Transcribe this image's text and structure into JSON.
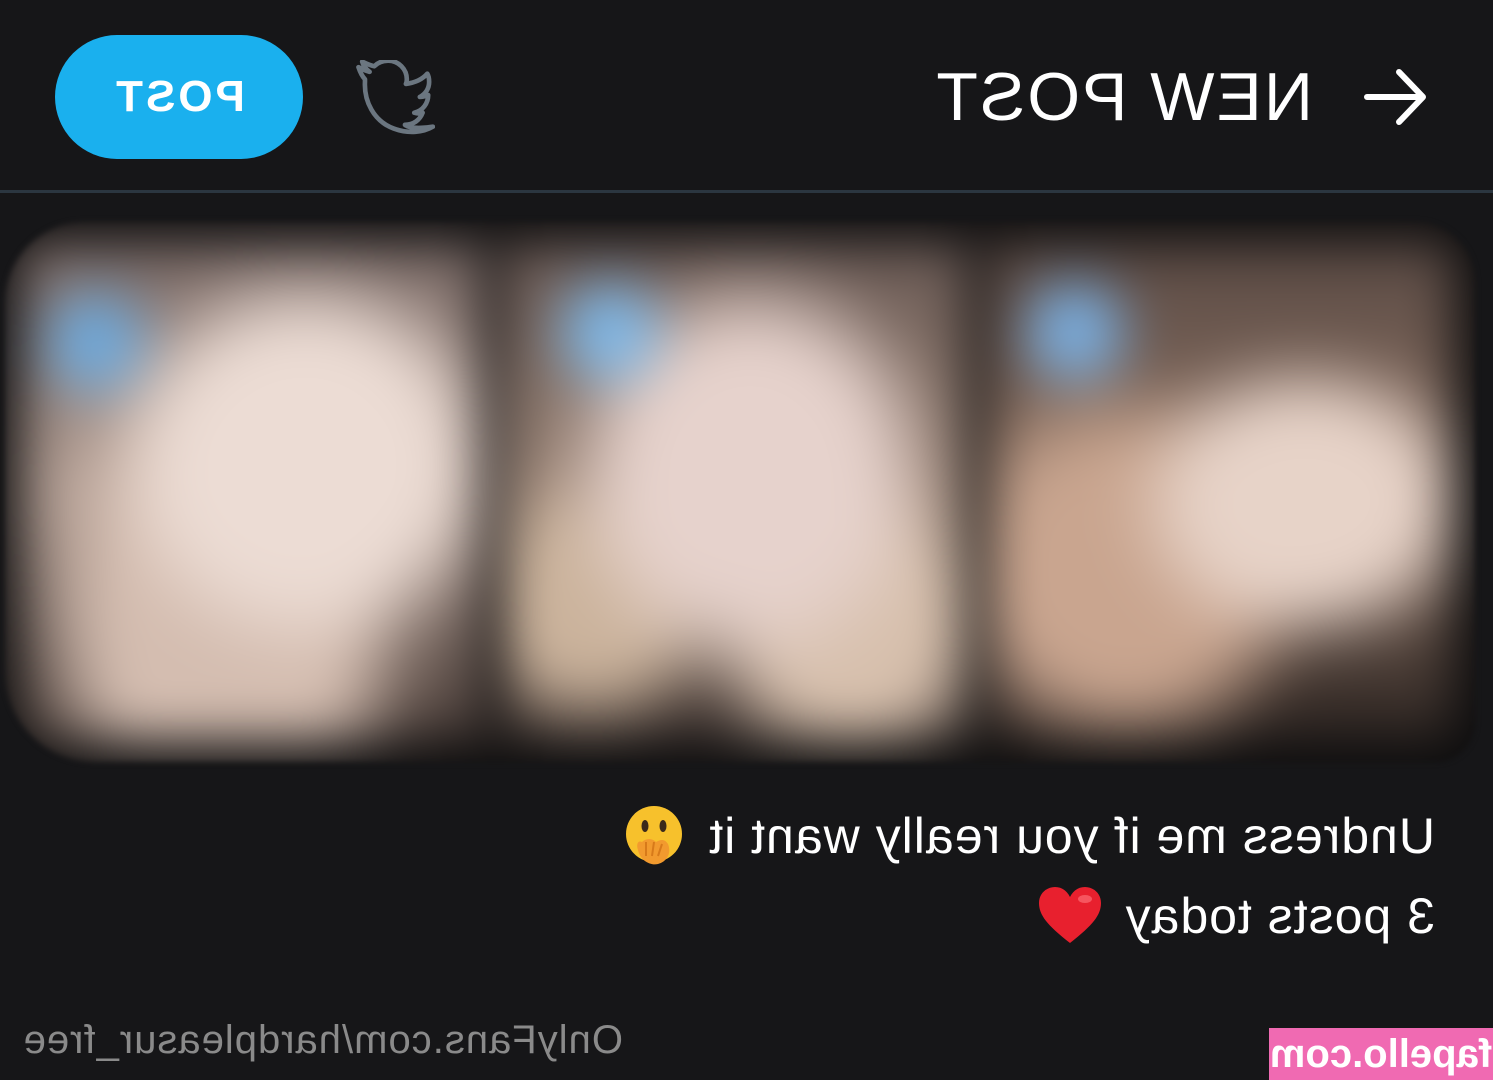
{
  "header": {
    "title": "NEW POST",
    "post_label": "POST",
    "back_icon": "arrow-left-icon",
    "twitter_icon": "twitter-bird-icon"
  },
  "media": {
    "thumbnail_count": 3,
    "blurred": true
  },
  "caption": {
    "line1": "Undress me if you really want it",
    "line1_emoji": "hand-over-mouth-emoji",
    "line2": "3 posts today",
    "line2_emoji": "red-heart-emoji"
  },
  "footer": {
    "profile_link": "OnlyFans.com/hardpleasur_free",
    "watermark": "fapello.com"
  },
  "colors": {
    "background": "#161618",
    "accent": "#1ab0ee",
    "divider": "#2b3640",
    "link_text": "#8a8a8a",
    "watermark_bg": "#f06ab2"
  }
}
